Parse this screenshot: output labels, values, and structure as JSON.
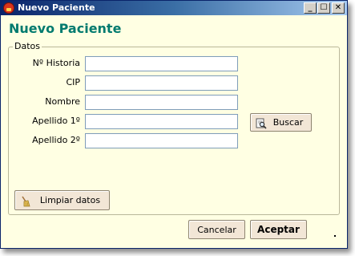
{
  "window": {
    "title": "Nuevo Paciente",
    "controls": {
      "minimize": "_",
      "maximize": "☐",
      "close": "✕"
    }
  },
  "heading": "Nuevo Paciente",
  "group": {
    "legend": "Datos",
    "fields": [
      {
        "label": "Nº Historia",
        "value": ""
      },
      {
        "label": "CIP",
        "value": ""
      },
      {
        "label": "Nombre",
        "value": ""
      },
      {
        "label": "Apellido 1º",
        "value": ""
      },
      {
        "label": "Apellido 2º",
        "value": ""
      }
    ],
    "search_button": {
      "label": "Buscar",
      "icon": "magnifier-document-icon"
    },
    "clear_button": {
      "label": "Limpiar datos",
      "icon": "broom-icon"
    }
  },
  "footer": {
    "cancel_label": "Cancelar",
    "accept_label": "Aceptar",
    "status_mark": "."
  },
  "colors": {
    "window_bg": "#ffffe3",
    "heading": "#007a6e",
    "button_bg": "#f2e6d6",
    "titlebar_start": "#0a246a",
    "titlebar_end": "#a6caf0"
  }
}
